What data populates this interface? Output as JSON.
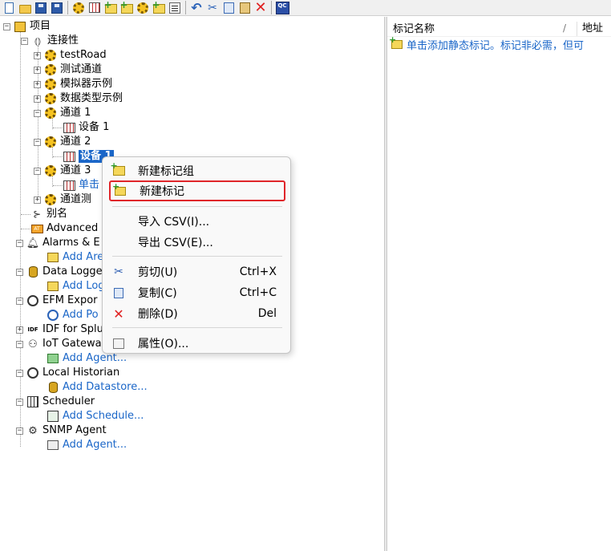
{
  "toolbar": {
    "icons": [
      "new-icon",
      "open-icon",
      "save-icon",
      "save-as-icon",
      "new-channel-icon",
      "new-device-icon",
      "new-tag-group-icon",
      "new-tag-icon",
      "channel-properties-icon",
      "tag-folder-icon",
      "properties-icon",
      "undo-icon",
      "cut-icon",
      "copy-icon",
      "paste-icon",
      "delete-icon",
      "quick-client-icon"
    ],
    "qc_label": "QC"
  },
  "tree": {
    "project": "项目",
    "connectivity": "连接性",
    "channels": [
      {
        "label": "testRoad"
      },
      {
        "label": "测试通道"
      },
      {
        "label": "模拟器示例"
      },
      {
        "label": "数据类型示例"
      },
      {
        "label": "通道 1",
        "device": "设备 1"
      },
      {
        "label": "通道 2",
        "device": "设备 1"
      },
      {
        "label": "通道 3",
        "device": "单击"
      },
      {
        "label": "通道测"
      }
    ],
    "alias": "别名",
    "advanced": "Advanced",
    "alarms": "Alarms & E",
    "alarms_add": "Add Are",
    "datalogger": "Data Logge",
    "datalogger_add": "Add Log",
    "efm": "EFM Expor",
    "efm_add": "Add Po",
    "idf": "IDF for Splu",
    "iot": "IoT Gatewa",
    "iot_add": "Add Agent...",
    "historian": "Local Historian",
    "historian_add": "Add Datastore...",
    "scheduler": "Scheduler",
    "scheduler_add": "Add Schedule...",
    "snmp": "SNMP Agent",
    "snmp_add": "Add Agent..."
  },
  "list": {
    "col_name": "标记名称",
    "col_sep": "/",
    "col_address": "地址",
    "hint": "单击添加静态标记。标记非必需，但可"
  },
  "context_menu": {
    "items": [
      {
        "label": "新建标记组",
        "shortcut": "",
        "icon": "new-tag-group-icon"
      },
      {
        "label": "新建标记",
        "shortcut": "",
        "icon": "new-tag-icon",
        "highlighted": true
      },
      {
        "label": "导入 CSV(I)...",
        "shortcut": "",
        "icon": ""
      },
      {
        "label": "导出 CSV(E)...",
        "shortcut": "",
        "icon": ""
      },
      {
        "label": "剪切(U)",
        "shortcut": "Ctrl+X",
        "icon": "cut-icon"
      },
      {
        "label": "复制(C)",
        "shortcut": "Ctrl+C",
        "icon": "copy-icon"
      },
      {
        "label": "删除(D)",
        "shortcut": "Del",
        "icon": "delete-icon"
      },
      {
        "label": "属性(O)...",
        "shortcut": "",
        "icon": "properties-icon"
      }
    ],
    "highlight_color": "#e0252a"
  },
  "colors": {
    "link": "#1a66c8",
    "selection": "#1a66c8"
  }
}
